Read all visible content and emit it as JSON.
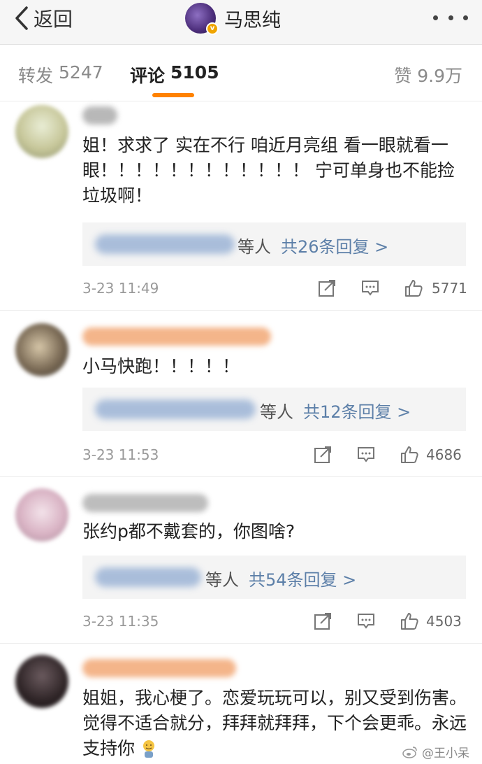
{
  "nav": {
    "back_label": "返回",
    "title": "马思纯",
    "verified_badge": "v"
  },
  "tabs": {
    "repost": {
      "label": "转发",
      "count": "5247"
    },
    "comments": {
      "label": "评论",
      "count": "5105"
    },
    "likes": {
      "label": "赞",
      "count": "9.9万"
    }
  },
  "colors": {
    "accent": "#ff8200",
    "link": "#5c7fa8"
  },
  "comments": [
    {
      "text": "姐！求求了 实在不行 咱近月亮组 看一眼就看一眼！！！！！！！！！！！！ 宁可单身也不能捡垃圾啊！",
      "reply_others": "等人",
      "reply_link": "共26条回复 >",
      "time": "3-23 11:49",
      "likes": "5771"
    },
    {
      "text": "小马快跑！！！！！",
      "reply_others": "等人",
      "reply_link": "共12条回复 >",
      "time": "3-23 11:53",
      "likes": "4686"
    },
    {
      "text": "张约p都不戴套的，你图啥?",
      "reply_others": "等人",
      "reply_link": "共54条回复 >",
      "time": "3-23 11:35",
      "likes": "4503"
    },
    {
      "text": "姐姐，我心梗了。恋爱玩玩可以，别又受到伤害。觉得不适合就分，拜拜就拜拜，下个会更乖。永远支持你"
    }
  ],
  "watermark": "@王小呆",
  "icons": [
    "back-chevron-icon",
    "more-dots-icon",
    "repost-icon",
    "comment-icon",
    "like-thumb-icon",
    "weibo-logo-icon",
    "emoji-icon"
  ]
}
